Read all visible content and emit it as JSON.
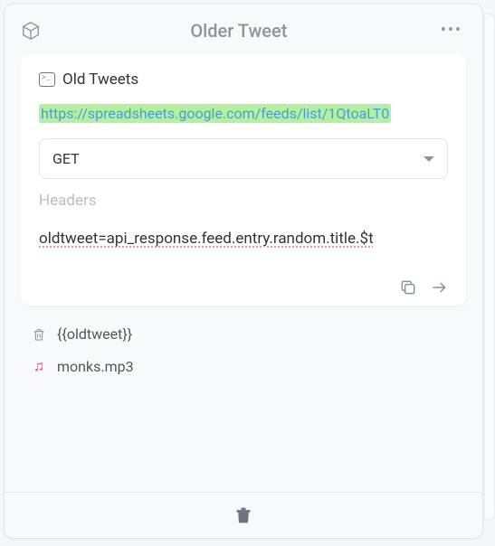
{
  "header": {
    "title": "Older Tweet"
  },
  "card": {
    "title": "Old Tweets",
    "url": "https://spreadsheets.google.com/feeds/list/1QtoaLT0",
    "method": "GET",
    "headers_placeholder": "Headers",
    "expression": "oldtweet=api_response.feed.entry.random.title.$t"
  },
  "rows": {
    "oldtweet_var": "{{oldtweet}}",
    "audio_file": "monks.mp3"
  }
}
